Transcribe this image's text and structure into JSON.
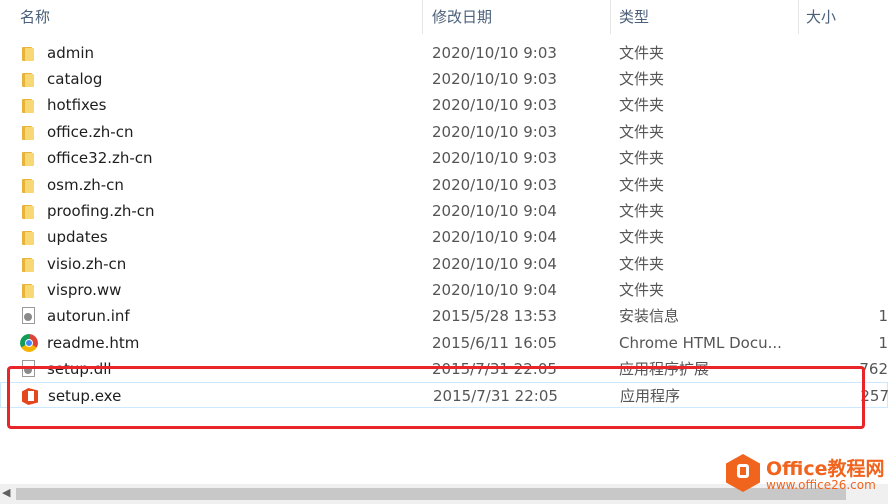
{
  "columns": {
    "name": "名称",
    "modified": "修改日期",
    "type": "类型",
    "size": "大小"
  },
  "files": [
    {
      "name": "admin",
      "date": "2020/10/10 9:03",
      "type": "文件夹",
      "size": "",
      "icon": "folder-icon"
    },
    {
      "name": "catalog",
      "date": "2020/10/10 9:03",
      "type": "文件夹",
      "size": "",
      "icon": "folder-icon"
    },
    {
      "name": "hotfixes",
      "date": "2020/10/10 9:03",
      "type": "文件夹",
      "size": "",
      "icon": "folder-icon"
    },
    {
      "name": "office.zh-cn",
      "date": "2020/10/10 9:03",
      "type": "文件夹",
      "size": "",
      "icon": "folder-icon"
    },
    {
      "name": "office32.zh-cn",
      "date": "2020/10/10 9:03",
      "type": "文件夹",
      "size": "",
      "icon": "folder-icon"
    },
    {
      "name": "osm.zh-cn",
      "date": "2020/10/10 9:03",
      "type": "文件夹",
      "size": "",
      "icon": "folder-icon"
    },
    {
      "name": "proofing.zh-cn",
      "date": "2020/10/10 9:04",
      "type": "文件夹",
      "size": "",
      "icon": "folder-icon"
    },
    {
      "name": "updates",
      "date": "2020/10/10 9:04",
      "type": "文件夹",
      "size": "",
      "icon": "folder-icon"
    },
    {
      "name": "visio.zh-cn",
      "date": "2020/10/10 9:04",
      "type": "文件夹",
      "size": "",
      "icon": "folder-icon"
    },
    {
      "name": "vispro.ww",
      "date": "2020/10/10 9:04",
      "type": "文件夹",
      "size": "",
      "icon": "folder-icon"
    },
    {
      "name": "autorun.inf",
      "date": "2015/5/28 13:53",
      "type": "安装信息",
      "size": "1",
      "icon": "settings-file-icon"
    },
    {
      "name": "readme.htm",
      "date": "2015/6/11 16:05",
      "type": "Chrome HTML Docu...",
      "size": "1",
      "icon": "chrome-icon"
    },
    {
      "name": "setup.dll",
      "date": "2015/7/31 22:05",
      "type": "应用程序扩展",
      "size": "762",
      "icon": "dll-file-icon"
    },
    {
      "name": "setup.exe",
      "date": "2015/7/31 22:05",
      "type": "应用程序",
      "size": "257",
      "icon": "office-setup-icon"
    }
  ],
  "selected_index": 13,
  "watermark": {
    "title": "Office教程网",
    "url": "www.office26.com"
  },
  "colors": {
    "highlight": "#e8262a",
    "folder": "#f8d775",
    "brand": "#f0641e"
  }
}
